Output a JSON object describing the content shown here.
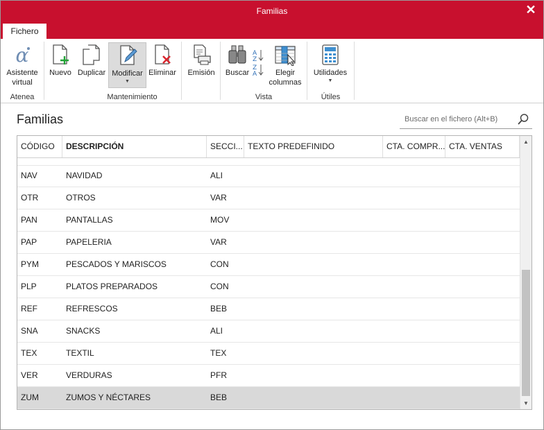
{
  "window": {
    "title": "Familias",
    "close_glyph": "✕"
  },
  "tabs": {
    "active": "Fichero"
  },
  "ribbon": {
    "groups": [
      {
        "title": "Atenea",
        "buttons": [
          {
            "line1": "Asistente",
            "line2": "virtual",
            "icon": "alpha-icon"
          }
        ]
      },
      {
        "title": "Mantenimiento",
        "buttons": [
          {
            "label": "Nuevo",
            "icon": "new-document-icon"
          },
          {
            "label": "Duplicar",
            "icon": "duplicate-icon"
          },
          {
            "label": "Modificar",
            "icon": "edit-document-icon",
            "has_dropdown": true
          },
          {
            "label": "Eliminar",
            "icon": "delete-document-icon"
          },
          {
            "label": "Emisión",
            "icon": "print-icon"
          }
        ]
      },
      {
        "title": "Vista",
        "buttons": [
          {
            "label": "Buscar",
            "icon": "binoculars-icon"
          },
          {
            "label": "",
            "icon": "sort-az-icon"
          },
          {
            "line1": "Elegir",
            "line2": "columnas",
            "icon": "choose-columns-icon"
          }
        ]
      },
      {
        "title": "Útiles",
        "buttons": [
          {
            "label": "Utilidades",
            "icon": "calculator-icon",
            "has_dropdown": true
          }
        ]
      }
    ]
  },
  "page": {
    "title": "Familias"
  },
  "search": {
    "placeholder": "Buscar en el fichero (Alt+B)",
    "icon": "search-icon"
  },
  "table": {
    "columns": [
      "CÓDIGO",
      "DESCRIPCIÓN",
      "SECCI...",
      "TEXTO PREDEFINIDO",
      "CTA. COMPR...",
      "CTA. VENTAS"
    ],
    "rows": [
      {
        "codigo": "NAV",
        "descripcion": "NAVIDAD",
        "seccion": "ALI"
      },
      {
        "codigo": "OTR",
        "descripcion": "OTROS",
        "seccion": "VAR"
      },
      {
        "codigo": "PAN",
        "descripcion": "PANTALLAS",
        "seccion": "MOV"
      },
      {
        "codigo": "PAP",
        "descripcion": "PAPELERIA",
        "seccion": "VAR"
      },
      {
        "codigo": "PYM",
        "descripcion": "PESCADOS Y MARISCOS",
        "seccion": "CON"
      },
      {
        "codigo": "PLP",
        "descripcion": "PLATOS PREPARADOS",
        "seccion": "CON"
      },
      {
        "codigo": "REF",
        "descripcion": "REFRESCOS",
        "seccion": "BEB"
      },
      {
        "codigo": "SNA",
        "descripcion": "SNACKS",
        "seccion": "ALI"
      },
      {
        "codigo": "TEX",
        "descripcion": "TEXTIL",
        "seccion": "TEX"
      },
      {
        "codigo": "VER",
        "descripcion": "VERDURAS",
        "seccion": "PFR"
      },
      {
        "codigo": "ZUM",
        "descripcion": "ZUMOS Y NÉCTARES",
        "seccion": "BEB",
        "selected": true
      }
    ]
  },
  "colors": {
    "brand": "#c8102e",
    "selected_row": "#d9d9d9"
  }
}
